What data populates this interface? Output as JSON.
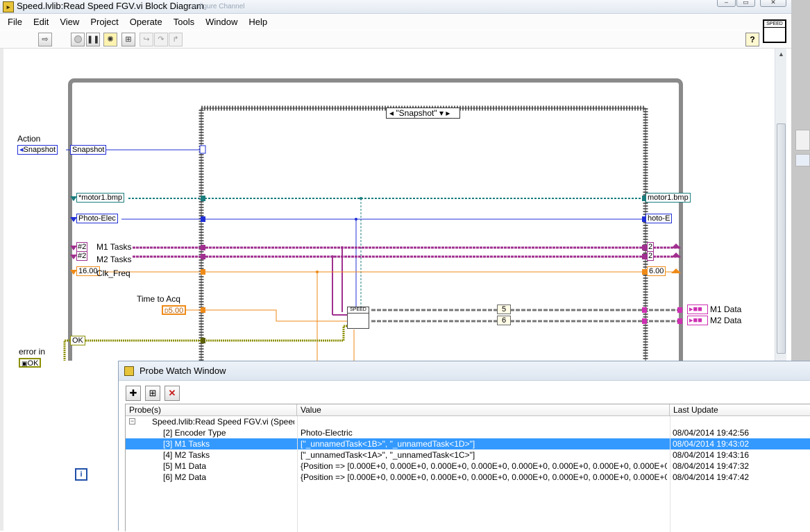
{
  "window": {
    "title": "Speed.lvlib:Read Speed FGV.vi Block Diagram",
    "ghost_title": "...onfigure Channel"
  },
  "menu": [
    "File",
    "Edit",
    "View",
    "Project",
    "Operate",
    "Tools",
    "Window",
    "Help"
  ],
  "vi_icon_label": "SPEED",
  "diagram": {
    "action_label": "Action",
    "action_value": "Snapshot",
    "action_value2": "Snapshot",
    "case_selector": "\"Snapshot\"",
    "file_constant": "*motor1.bmp",
    "file_constant_right": "motor1.bmp",
    "encoder_constant": "Photo-Elec",
    "encoder_constant_right": "hoto-E",
    "m1_tasks_label": "M1 Tasks",
    "m2_tasks_label": "M2 Tasks",
    "task_tag": "#2",
    "clk_label": "Clk_Freq",
    "clk_value": "16.00",
    "clk_value_right": "6.00",
    "time_label": "Time to Acq",
    "time_value": "5.00",
    "error_label": "error in",
    "error_ok": "OK",
    "error_ok2": "OK",
    "subvi_label": "SPEED",
    "probe_5": "5",
    "probe_6": "6",
    "m1_data_label": "M1 Data",
    "m2_data_label": "M2 Data",
    "shift_right_1": "2",
    "shift_right_2": "2",
    "loop_index": "i"
  },
  "probe_window": {
    "title": "Probe Watch Window",
    "columns": [
      "Probe(s)",
      "Value",
      "Last Update"
    ],
    "rows": [
      {
        "probe": "Speed.lvlib:Read Speed FGV.vi (Speed.lv",
        "value": "",
        "updated": "",
        "group": true
      },
      {
        "probe": "[2] Encoder Type",
        "value": "Photo-Electric",
        "updated": "08/04/2014 19:42:56"
      },
      {
        "probe": "[3] M1 Tasks",
        "value": "[\"_unnamedTask<1B>\", \"_unnamedTask<1D>\"]",
        "updated": "08/04/2014 19:43:02",
        "selected": true
      },
      {
        "probe": "[4] M2 Tasks",
        "value": "[\"_unnamedTask<1A>\", \"_unnamedTask<1C>\"]",
        "updated": "08/04/2014 19:43:16"
      },
      {
        "probe": "[5] M1 Data",
        "value": "{Position => [0.000E+0, 0.000E+0, 0.000E+0, 0.000E+0, 0.000E+0, 0.000E+0, 0.000E+0, 0.000E+0, 0.000E",
        "updated": "08/04/2014 19:47:32"
      },
      {
        "probe": "[6] M2 Data",
        "value": "{Position => [0.000E+0, 0.000E+0, 0.000E+0, 0.000E+0, 0.000E+0, 0.000E+0, 0.000E+0, 0.000E+0, 0.000E",
        "updated": "08/04/2014 19:47:42"
      }
    ]
  },
  "colors": {
    "wire_path": "#1b7d7d",
    "wire_enum": "#1f2fd6",
    "wire_task": "#a0308f",
    "wire_dbl": "#ef8a17",
    "wire_error": "#8c8f00",
    "selection": "#3399ff"
  }
}
